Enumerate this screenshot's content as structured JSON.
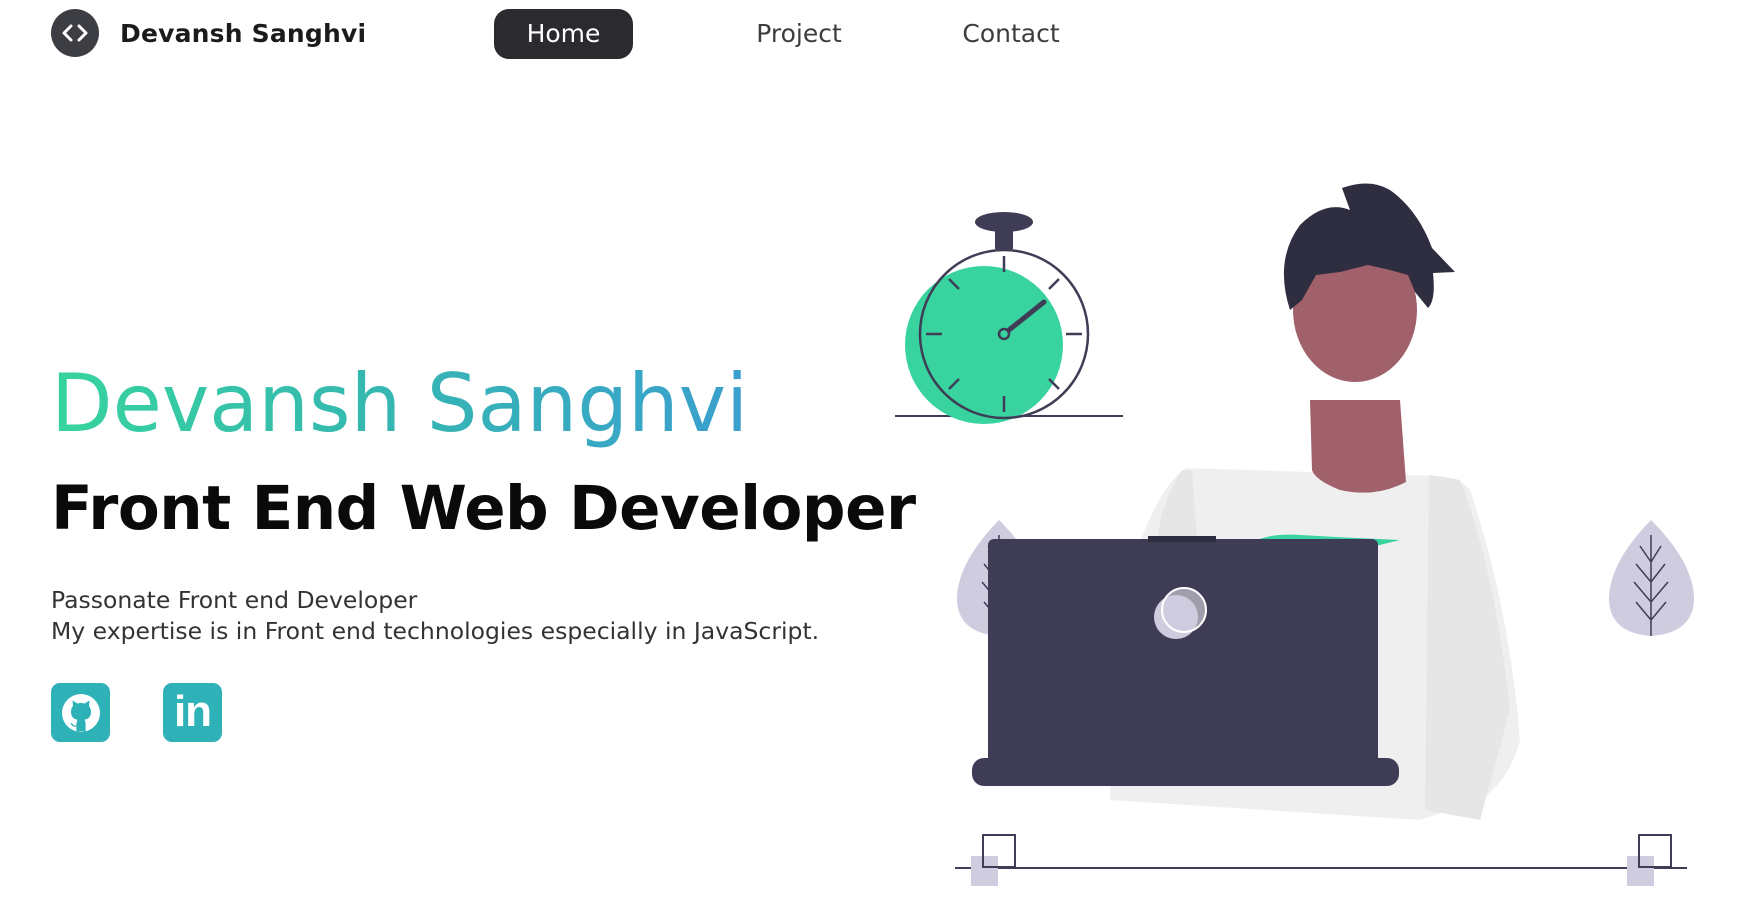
{
  "header": {
    "brand_name": "Devansh Sanghvi",
    "logo_icon": "code-brackets-icon",
    "nav": [
      {
        "label": "Home",
        "active": true
      },
      {
        "label": "Project",
        "active": false
      },
      {
        "label": "Contact",
        "active": false
      }
    ]
  },
  "hero": {
    "name": "Devansh Sanghvi",
    "role": "Front End Web Developer",
    "description": [
      "Passonate Front end Developer",
      "My expertise is in Front end technologies especially in JavaScript."
    ],
    "social": [
      {
        "icon": "github-icon"
      },
      {
        "icon": "linkedin-icon",
        "text": "in"
      }
    ]
  },
  "colors": {
    "accent_green": "#37d49e",
    "accent_blue": "#3a9fce",
    "social_teal": "#2fb1b8",
    "nav_active_bg": "#2b2b2f",
    "laptop": "#3f3d56",
    "leaf": "#cfcce0"
  }
}
